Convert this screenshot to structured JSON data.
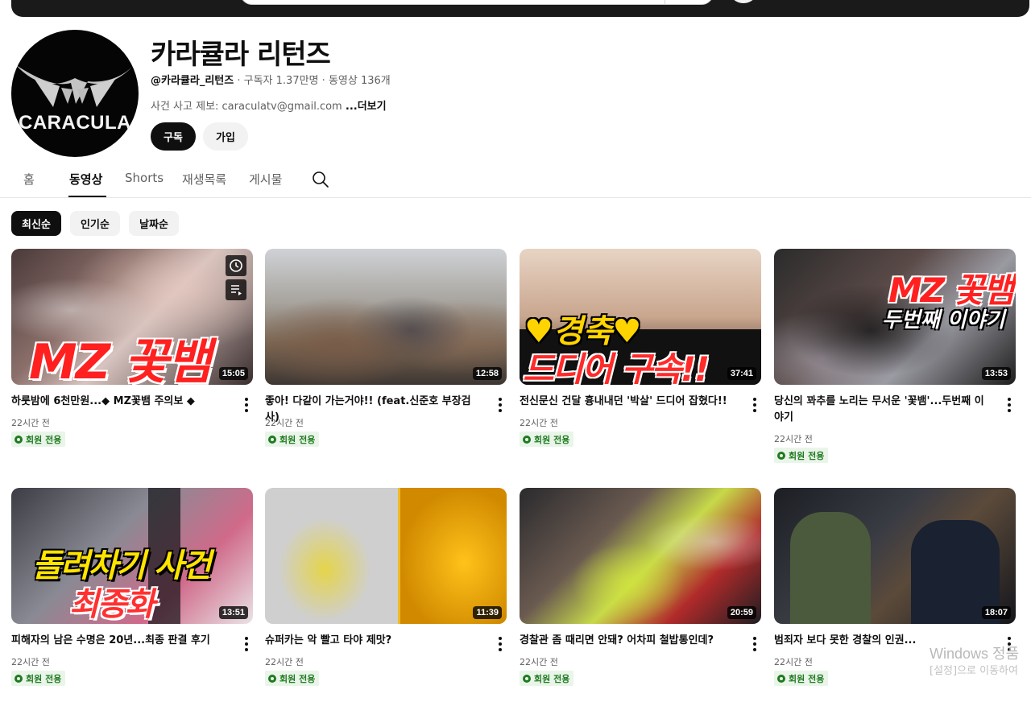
{
  "channel": {
    "logo_text": "CARACULA",
    "name": "카라큘라 리턴즈",
    "handle": "@카라큘라_리턴즈",
    "subscribers": "구독자 1.37만명",
    "video_count": "동영상 136개",
    "description": "사건 사고 제보: caraculatv@gmail.com",
    "more_label": "...더보기",
    "subscribe_label": "구독",
    "join_label": "가입"
  },
  "tabs": [
    {
      "label": "홈"
    },
    {
      "label": "동영상"
    },
    {
      "label": "Shorts"
    },
    {
      "label": "재생목록"
    },
    {
      "label": "게시물"
    }
  ],
  "chips": [
    {
      "label": "최신순",
      "active": true
    },
    {
      "label": "인기순",
      "active": false
    },
    {
      "label": "날짜순",
      "active": false
    }
  ],
  "videos": [
    {
      "title": "하룻밤에 6천만원...◆ MZ꽃뱀 주의보 ◆",
      "time": "22시간 전",
      "badge": "회원 전용",
      "duration": "15:05",
      "overlay": "MZ 꽃뱀"
    },
    {
      "title": "좋아! 다같이 가는거야!! (feat.신준호 부장검사)",
      "time": "22시간 전",
      "badge": "회원 전용",
      "duration": "12:58"
    },
    {
      "title": "전신문신 건달 흉내내던 '박살' 드디어 잡혔다!!",
      "time": "22시간 전",
      "badge": "회원 전용",
      "duration": "37:41",
      "overlay_line1": "♥경축♥",
      "overlay_line2": "드디어 구속!!"
    },
    {
      "title": "당신의 꽈추를 노리는 무서운 '꽃뱀'...두번째 이야기",
      "time": "22시간 전",
      "badge": "회원 전용",
      "duration": "13:53",
      "overlay_line1": "MZ 꽃뱀",
      "overlay_line2": "두번째 이야기"
    },
    {
      "title": "피해자의 남은 수명은 20년...최종 판결 후기",
      "time": "22시간 전",
      "badge": "회원 전용",
      "duration": "13:51",
      "overlay_line1": "돌려차기 사건",
      "overlay_line2": "최종화"
    },
    {
      "title": "슈퍼카는 악 빨고 타야 제맛?",
      "time": "22시간 전",
      "badge": "회원 전용",
      "duration": "11:39"
    },
    {
      "title": "경찰관 좀 때리면 안돼? 어차피 철밥통인데?",
      "time": "22시간 전",
      "badge": "회원 전용",
      "duration": "20:59"
    },
    {
      "title": "범죄자 보다 못한 경찰의 인권...",
      "time": "22시간 전",
      "badge": "회원 전용",
      "duration": "18:07"
    }
  ],
  "watermark": {
    "line1": "Windows 정품",
    "line2": "[설정]으로 이동하여"
  }
}
